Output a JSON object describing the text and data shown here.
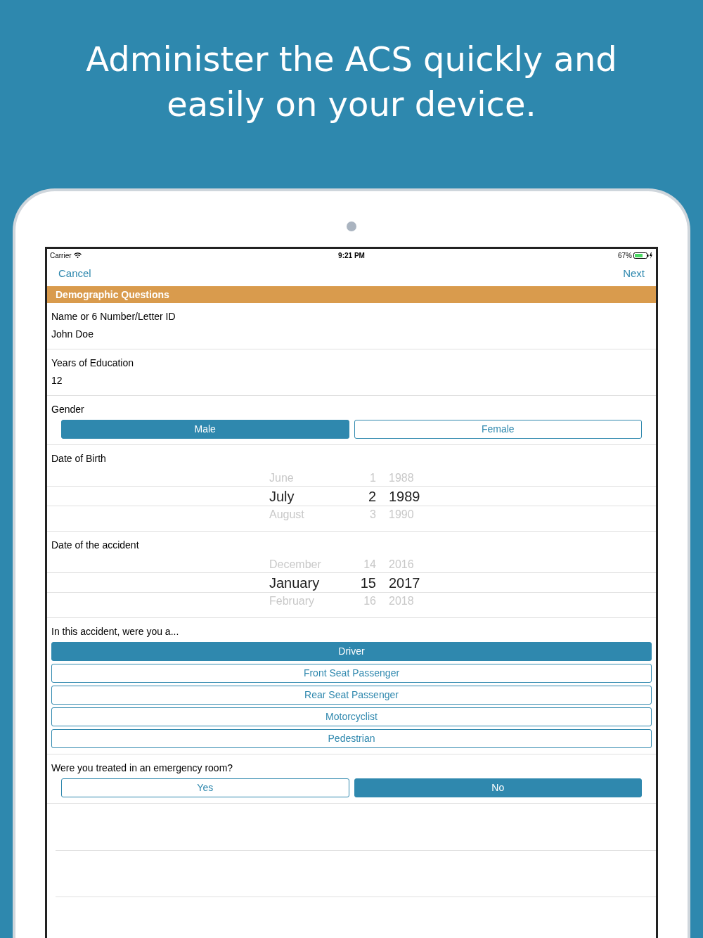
{
  "headline": "Administer the ACS quickly and easily on your device.",
  "status_bar": {
    "carrier": "Carrier",
    "time": "9:21 PM",
    "battery": "67%"
  },
  "nav": {
    "left": "Cancel",
    "right": "Next"
  },
  "section_header": "Demographic Questions",
  "questions": [
    {
      "kind": "text",
      "label": "Name or 6 Number/Letter ID",
      "value": "John Doe"
    },
    {
      "kind": "text",
      "label": "Years of Education",
      "value": "12"
    },
    {
      "kind": "choice",
      "label": "Gender",
      "options": [
        {
          "label": "Male",
          "selected": true
        },
        {
          "label": "Female",
          "selected": false
        }
      ]
    },
    {
      "kind": "date",
      "label": "Date of Birth",
      "rows": [
        {
          "month": "June",
          "day": "1",
          "year": "1988",
          "selected": false
        },
        {
          "month": "July",
          "day": "2",
          "year": "1989",
          "selected": true
        },
        {
          "month": "August",
          "day": "3",
          "year": "1990",
          "selected": false
        }
      ]
    },
    {
      "kind": "date",
      "label": "Date of the accident",
      "rows": [
        {
          "month": "December",
          "day": "14",
          "year": "2016",
          "selected": false
        },
        {
          "month": "January",
          "day": "15",
          "year": "2017",
          "selected": true
        },
        {
          "month": "February",
          "day": "16",
          "year": "2018",
          "selected": false
        }
      ]
    },
    {
      "kind": "list",
      "label": "In this accident, were you a...",
      "options": [
        {
          "label": "Driver",
          "selected": true
        },
        {
          "label": "Front Seat Passenger",
          "selected": false
        },
        {
          "label": "Rear Seat Passenger",
          "selected": false
        },
        {
          "label": "Motorcyclist",
          "selected": false
        },
        {
          "label": "Pedestrian",
          "selected": false
        }
      ]
    },
    {
      "kind": "choice",
      "label": "Were you treated in an emergency room?",
      "options": [
        {
          "label": "Yes",
          "selected": false
        },
        {
          "label": "No",
          "selected": true
        }
      ]
    }
  ]
}
